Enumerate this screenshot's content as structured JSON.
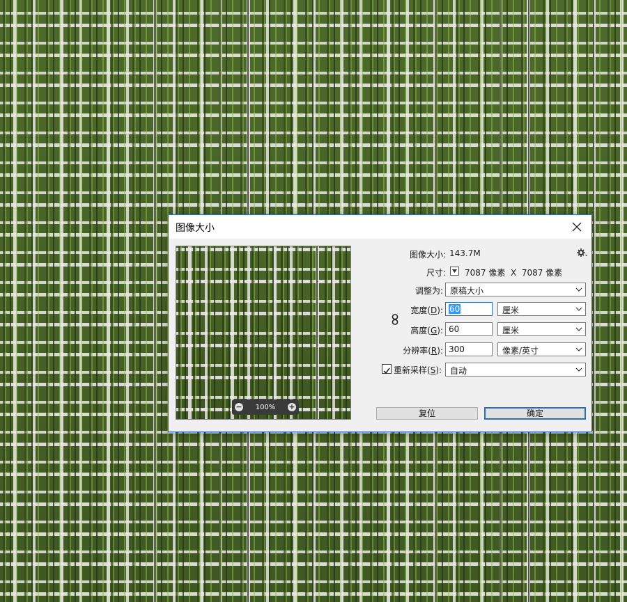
{
  "dialog": {
    "title": "图像大小",
    "image_size_label": "图像大小:",
    "image_size_value": "143.7M",
    "dimensions_label": "尺寸:",
    "dimensions_value": "7087 像素  X  7087 像素",
    "fit_to_label": "调整为:",
    "fit_to_value": "原稿大小",
    "width_label_pre": "宽度(",
    "width_label_key": "D",
    "width_label_post": "):",
    "width_value": "60",
    "width_unit": "厘米",
    "height_label_pre": "高度(",
    "height_label_key": "G",
    "height_label_post": "):",
    "height_value": "60",
    "height_unit": "厘米",
    "resolution_label_pre": "分辨率(",
    "resolution_label_key": "R",
    "resolution_label_post": "):",
    "resolution_value": "300",
    "resolution_unit": "像素/英寸",
    "resample_label_pre": "重新采样(",
    "resample_label_key": "S",
    "resample_label_post": "):",
    "resample_checked": true,
    "resample_value": "自动",
    "reset_label": "复位",
    "ok_label": "确定",
    "zoom_level": "100%",
    "zoom_out": "−",
    "zoom_in": "+"
  },
  "colors": {
    "accent": "#2b6fc2",
    "dialog_bg": "#f0f0f0",
    "selection": "#3399ff"
  },
  "icons": [
    "close-icon",
    "gear-icon",
    "chevron-down-icon",
    "chain-link-icon",
    "check-icon",
    "zoom-out-icon",
    "zoom-in-icon",
    "triangle-down-icon"
  ]
}
